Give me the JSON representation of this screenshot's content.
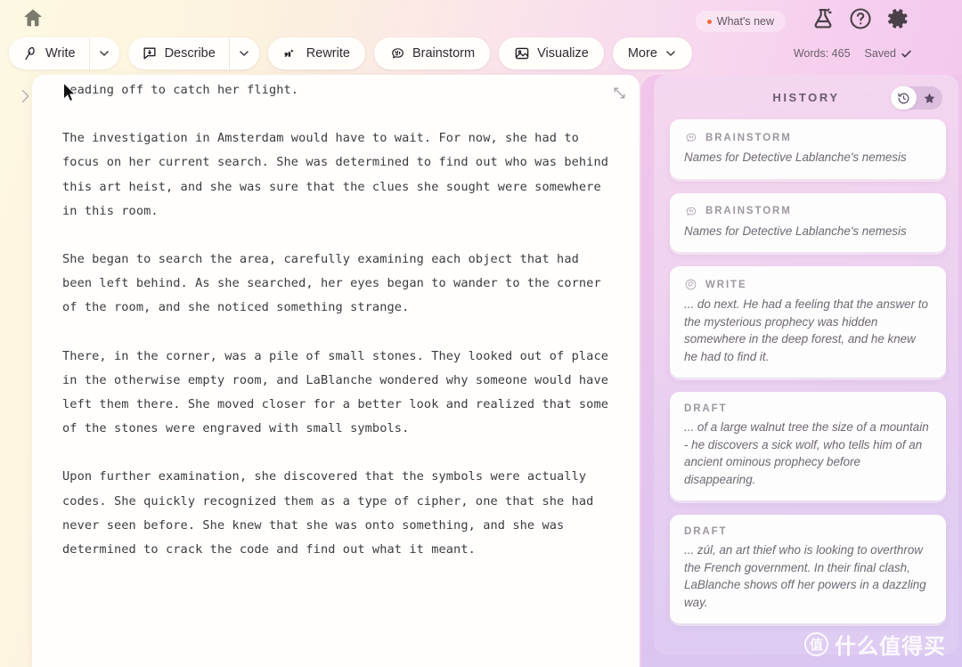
{
  "topbar": {
    "home_icon": "home-icon",
    "whats_new_label": "What's new",
    "whats_new_dot_color": "#ef6c3f",
    "flask_icon": "flask-icon",
    "help_icon": "help-circle-icon",
    "gear_icon": "gear-icon",
    "word_count": "Words: 465",
    "save_status": "Saved"
  },
  "toolbar": {
    "buttons": [
      {
        "label": "Write",
        "icon": "quill-pen-icon",
        "has_caret": true
      },
      {
        "label": "Describe",
        "icon": "describe-box-icon",
        "has_caret": true
      },
      {
        "label": "Rewrite",
        "icon": "rewrite-sparkle-icon",
        "has_caret": false
      },
      {
        "label": "Brainstorm",
        "icon": "brain-icon",
        "has_caret": false
      },
      {
        "label": "Visualize",
        "icon": "image-icon",
        "has_caret": false
      },
      {
        "label": "More",
        "icon": null,
        "has_caret": true
      }
    ]
  },
  "editor": {
    "collapse_icon": "chevron-right-icon",
    "expand_icon": "expand-diagonal-icon",
    "paragraphs": [
      "heading off to catch her flight.",
      "The investigation in Amsterdam would have to wait. For now, she had to focus on her current search. She was determined to find out who was behind this art heist, and she was sure that the clues she sought were somewhere in this room.",
      "She began to search the area, carefully examining each object that had been left behind. As she searched, her eyes began to wander to the corner of the room, and she noticed something strange.",
      "There, in the corner, was a pile of small stones. They looked out of place in the otherwise empty room, and LaBlanche wondered why someone would have left them there. She moved closer for a better look and realized that some of the stones were engraved with small symbols.",
      "Upon further examination, she discovered that the symbols were actually codes. She quickly recognized them as a type of cipher, one that she had never seen before. She knew that she was onto something, and she was determined to crack the code and find out what it meant."
    ]
  },
  "history": {
    "title": "HISTORY",
    "toggle": {
      "clock_icon": "clock-history-icon",
      "star_icon": "star-icon",
      "active": "clock"
    },
    "cards": [
      {
        "type": "BRAINSTORM",
        "icon": "brain-icon",
        "text": "Names for Detective Lablanche's nemesis"
      },
      {
        "type": "BRAINSTORM",
        "icon": "brain-icon",
        "text": "Names for Detective Lablanche's nemesis"
      },
      {
        "type": "WRITE",
        "icon": "spiral-icon",
        "text": "... do next. He had a feeling that the answer to the mysterious prophecy was hidden somewhere in the deep forest, and he knew he had to find it."
      },
      {
        "type": "DRAFT",
        "icon": null,
        "text": "... of a large walnut tree the size of a mountain - he discovers a sick wolf, who tells him of an ancient ominous prophecy before disappearing."
      },
      {
        "type": "DRAFT",
        "icon": null,
        "text": "... zúl, an art thief who is looking to overthrow the French government. In their final clash, LaBlanche shows off her powers in a dazzling way."
      }
    ]
  },
  "watermark": {
    "badge": "值",
    "text": "什么值得买"
  }
}
